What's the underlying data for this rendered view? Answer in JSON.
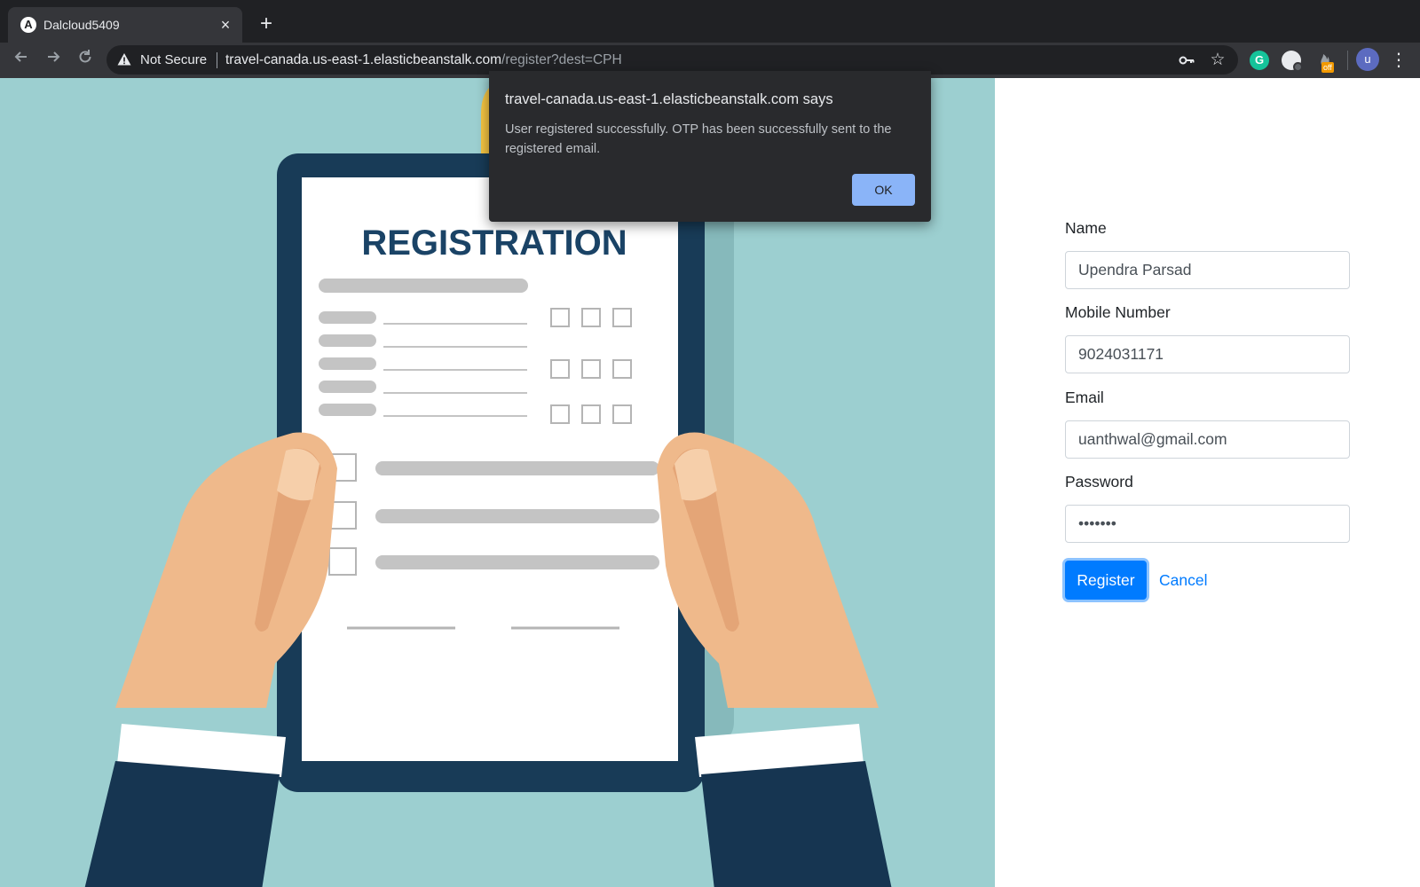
{
  "browser": {
    "tab": {
      "favicon_letter": "A",
      "title": "Dalcloud5409",
      "close_glyph": "×"
    },
    "new_tab_glyph": "+",
    "security_label": "Not Secure",
    "url_host": "travel-canada.us-east-1.elasticbeanstalk.com",
    "url_path": "/register?dest=CPH",
    "extensions": {
      "grammarly_letter": "G",
      "off_badge": "off"
    },
    "avatar_letter": "u"
  },
  "hero": {
    "illustration_heading": "REGISTRATION"
  },
  "form": {
    "name_label": "Name",
    "name_value": "Upendra Parsad",
    "mobile_label": "Mobile Number",
    "mobile_value": "9024031171",
    "email_label": "Email",
    "email_value": "uanthwal@gmail.com",
    "password_label": "Password",
    "password_value": "•••••••",
    "register_label": "Register",
    "cancel_label": "Cancel"
  },
  "dialog": {
    "title": "travel-canada.us-east-1.elasticbeanstalk.com says",
    "message": "User registered successfully. OTP has been successfully sent to the registered email.",
    "ok_label": "OK"
  },
  "colors": {
    "accent": "#007bff",
    "hero_background": "#9ccfd0",
    "dialog_background": "#292a2d",
    "dialog_button": "#8ab4f8",
    "chrome_dark": "#202124"
  }
}
